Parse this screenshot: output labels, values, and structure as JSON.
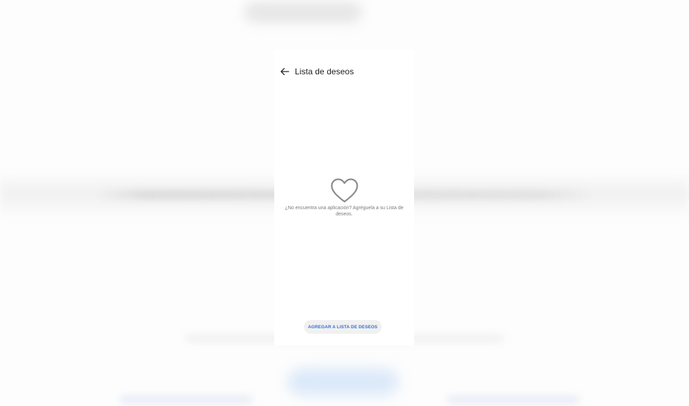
{
  "appbar": {
    "back_icon": "arrow-left-icon",
    "title": "Lista de deseos"
  },
  "empty_state": {
    "icon": "heart-outline-icon",
    "message": "¿No encuentra una aplicación? Agréguela a su Lista de deseos."
  },
  "actions": {
    "add_button_label": "AGREGAR A LISTA DE DESEOS"
  },
  "colors": {
    "accent": "#2f6fd6",
    "icon_gray": "#8a8a8a",
    "button_bg": "#f1f1f1"
  }
}
